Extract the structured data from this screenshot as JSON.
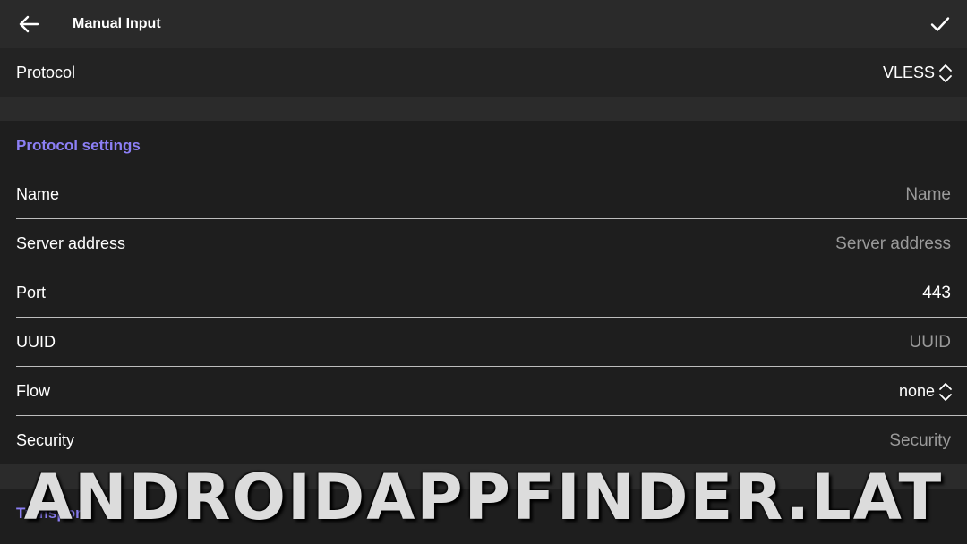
{
  "topbar": {
    "title": "Manual Input",
    "back_icon": "arrow-left-icon",
    "confirm_icon": "check-icon"
  },
  "protocol": {
    "label": "Protocol",
    "value": "VLESS",
    "icon": "unfold-icon"
  },
  "protocol_settings": {
    "header": "Protocol settings",
    "fields": {
      "name": {
        "label": "Name",
        "placeholder": "Name"
      },
      "server_address": {
        "label": "Server address",
        "placeholder": "Server address"
      },
      "port": {
        "label": "Port",
        "value": "443"
      },
      "uuid": {
        "label": "UUID",
        "placeholder": "UUID"
      },
      "flow": {
        "label": "Flow",
        "value": "none",
        "icon": "unfold-icon"
      },
      "security": {
        "label": "Security",
        "placeholder": "Security"
      }
    }
  },
  "transport": {
    "header": "Transport"
  },
  "watermark": "ANDROIDAPPFINDER.LAT",
  "colors": {
    "accent": "#8c7ff5",
    "background": "#1e1e1e",
    "topbar": "#2a2a2a",
    "placeholder": "#9a9a9a"
  }
}
